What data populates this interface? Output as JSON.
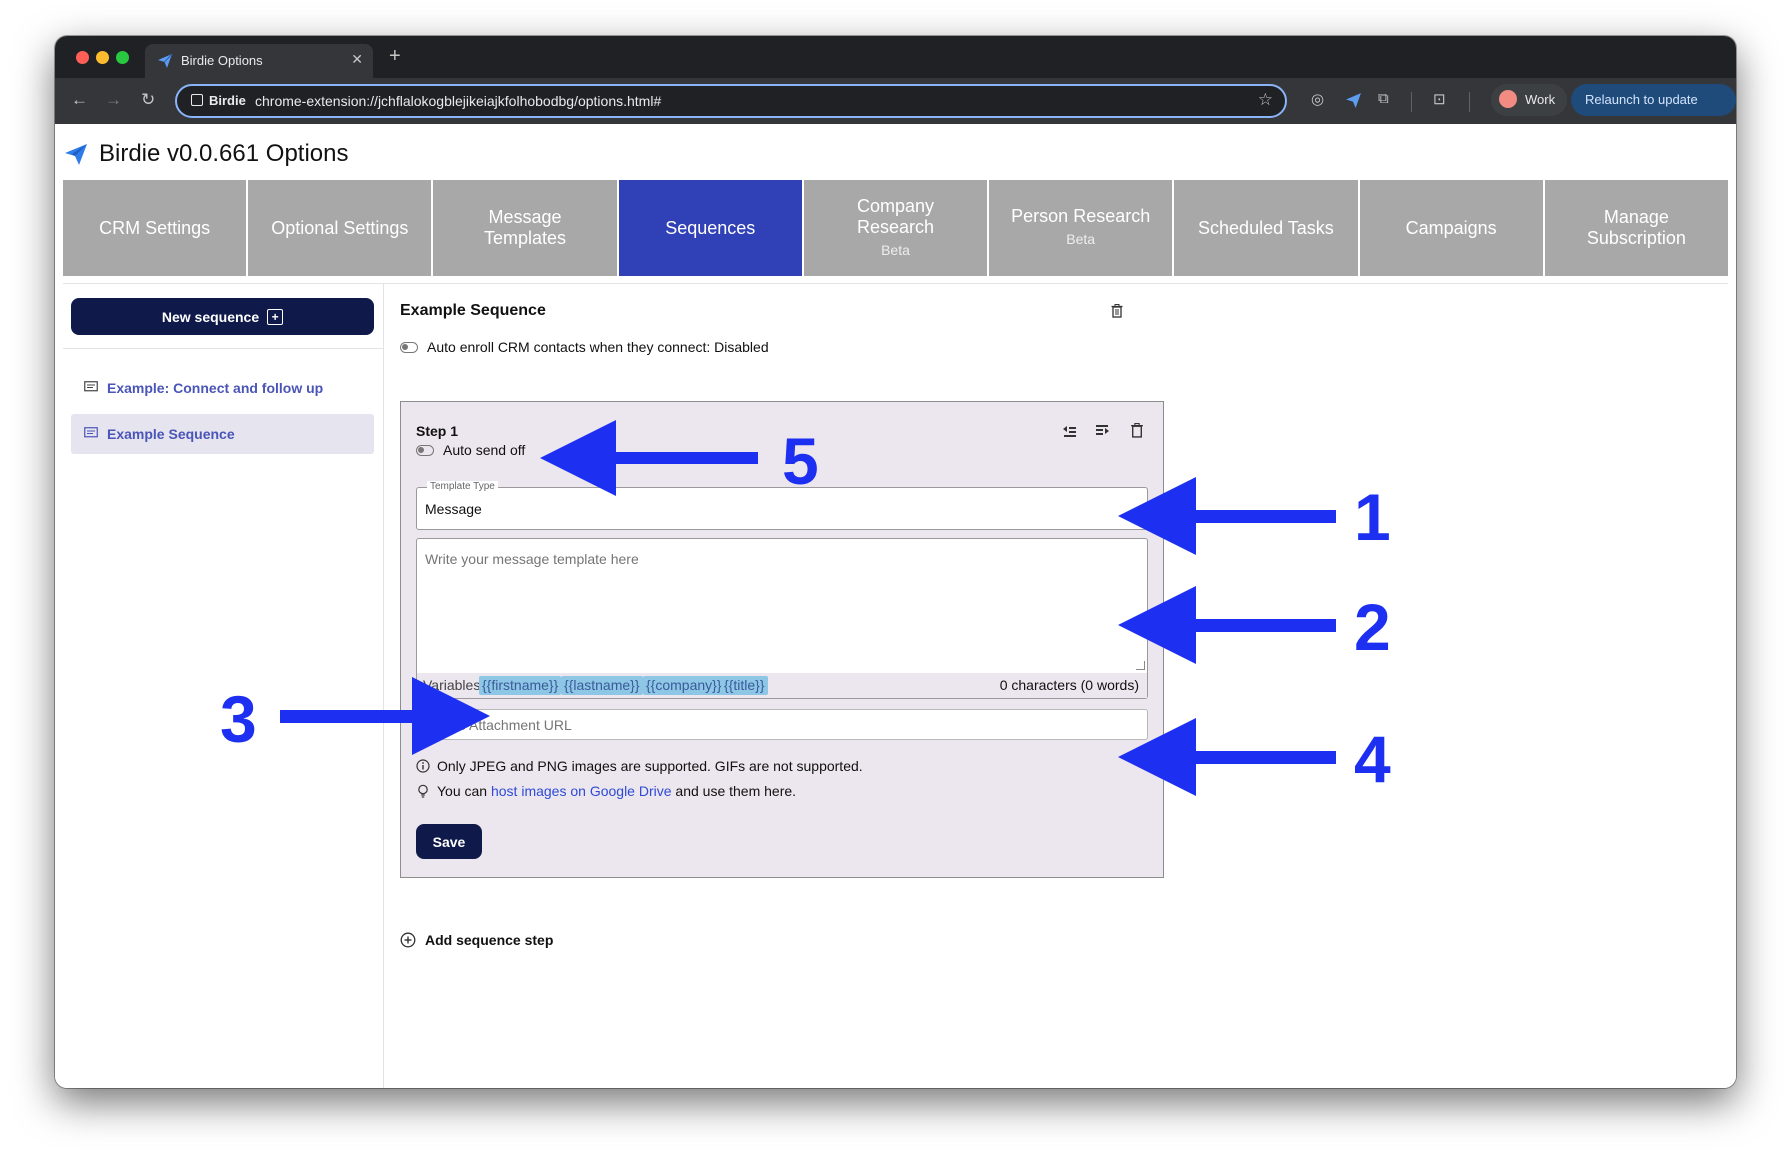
{
  "browser": {
    "tab_title": "Birdie Options",
    "tab_close": "✕",
    "new_tab": "+",
    "omnibox_chip": "Birdie",
    "url": "chrome-extension://jchflalokogblejikeiajkfolhobodbg/options.html#",
    "profile_label": "Work",
    "relaunch_label": "Relaunch to update",
    "relaunch_menu": "⋮"
  },
  "app": {
    "title": "Birdie v0.0.661 Options",
    "brand_color": "#2f7be8"
  },
  "nav_tabs": [
    {
      "label": "CRM Settings",
      "sub": ""
    },
    {
      "label": "Optional Settings",
      "sub": ""
    },
    {
      "label": "Message Templates",
      "sub": ""
    },
    {
      "label": "Sequences",
      "sub": "",
      "active": true
    },
    {
      "label": "Company Research",
      "sub": "Beta"
    },
    {
      "label": "Person Research",
      "sub": "Beta"
    },
    {
      "label": "Scheduled Tasks",
      "sub": ""
    },
    {
      "label": "Campaigns",
      "sub": ""
    },
    {
      "label": "Manage Subscription",
      "sub": ""
    }
  ],
  "sidebar": {
    "new_sequence_label": "New sequence",
    "items": [
      {
        "label": "Example: Connect and follow up",
        "selected": false
      },
      {
        "label": "Example Sequence",
        "selected": true
      }
    ]
  },
  "sequence": {
    "title": "Example Sequence",
    "auto_enroll_text": "Auto enroll CRM contacts when they connect: Disabled",
    "step": {
      "label": "Step 1",
      "auto_send_text": "Auto send off",
      "template_type_legend": "Template Type",
      "template_type_value": "Message",
      "message_placeholder": "Write your message template here",
      "variables_label": "Variables",
      "variables": [
        "{{firstname}}",
        "{{lastname}}",
        "{{company}}",
        "{{title}}"
      ],
      "char_count": "0 characters (0 words)",
      "image_url_placeholder": "Image Attachment URL",
      "note_formats": "Only JPEG and PNG images are supported. GIFs are not supported.",
      "note_drive_prefix": "You can",
      "note_drive_link": "host images on Google Drive",
      "note_drive_suffix": "and use them here.",
      "save_label": "Save"
    },
    "add_step_label": "Add sequence step"
  },
  "annotations": {
    "color": "#1d2ff0",
    "numbers": [
      "1",
      "2",
      "3",
      "4",
      "5"
    ]
  }
}
